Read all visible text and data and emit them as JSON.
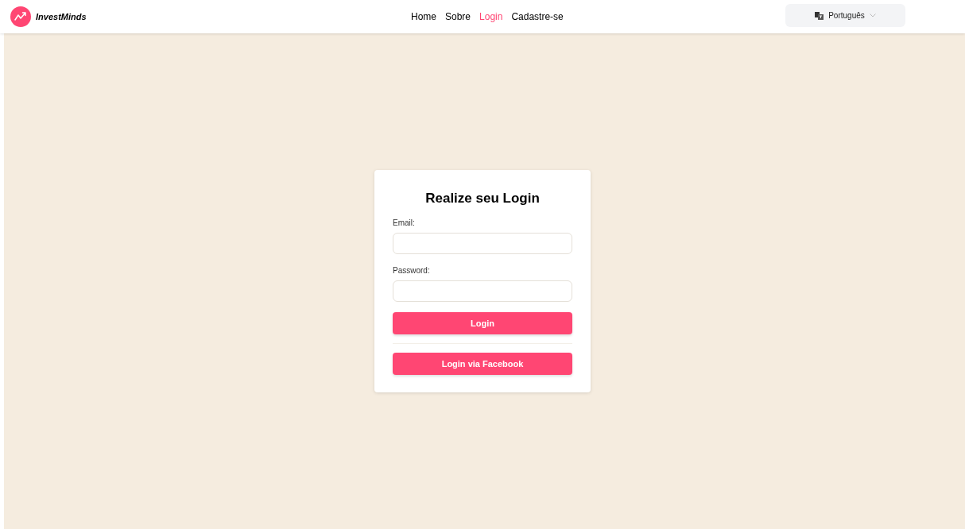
{
  "header": {
    "brand": "InvestMinds",
    "nav": [
      {
        "label": "Home",
        "selected": false
      },
      {
        "label": "Sobre",
        "selected": false
      },
      {
        "label": "Login",
        "selected": true
      },
      {
        "label": "Cadastre-se",
        "selected": false
      }
    ],
    "language": "Português"
  },
  "login_form": {
    "title": "Realize seu Login",
    "fields": [
      {
        "label": "Email:"
      },
      {
        "label": "Password:"
      }
    ],
    "buttons": [
      "Login",
      "Login via Facebook"
    ]
  }
}
